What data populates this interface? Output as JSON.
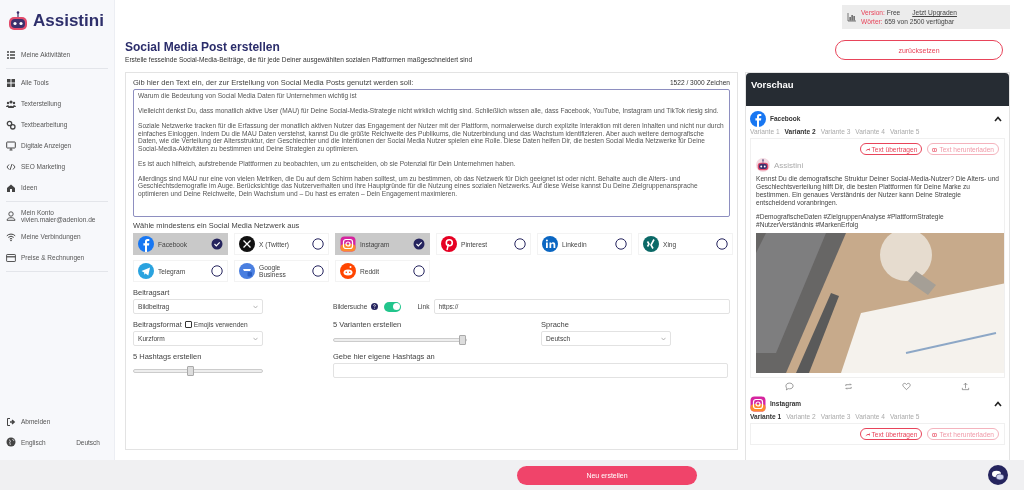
{
  "brand": {
    "name": "Assistini"
  },
  "usage": {
    "version_label": "Version:",
    "version": "Free",
    "upgrade_link": "Jetzt Upgraden",
    "words_label": "Wörter:",
    "words": "659 von 2500 verfügbar"
  },
  "sidebar": {
    "sections": [
      {
        "items": [
          {
            "label": "Meine Aktivitäten"
          }
        ]
      },
      {
        "items": [
          {
            "label": "Alle Tools"
          },
          {
            "label": "Texterstellung"
          },
          {
            "label": "Textbearbeitung"
          },
          {
            "label": "Digitale Anzeigen"
          },
          {
            "label": "SEO Marketing"
          },
          {
            "label": "Ideen"
          }
        ]
      },
      {
        "items": [
          {
            "label": "Mein Konto",
            "sublabel": "vivien.maier@adenion.de"
          },
          {
            "label": "Meine Verbindungen"
          },
          {
            "label": "Preise & Rechnungen"
          }
        ]
      }
    ],
    "logout": "Abmelden",
    "languages": [
      "Englisch",
      "Deutsch"
    ]
  },
  "page": {
    "title": "Social Media Post erstellen",
    "subtitle": "Erstelle fesselnde Social-Media-Beiträge, die für jede Deiner ausgewählten sozialen Plattformen maßgeschneidert sind",
    "reset_button": "zurücksetzen"
  },
  "input": {
    "label": "Gib hier den Text ein, der zur Erstellung von Social Media Posts genutzt werden soll:",
    "counter": "1522 / 3000 Zeichen",
    "paragraphs": [
      "Warum die Bedeutung von Social Media Daten für Unternehmen wichtig ist",
      "Vielleicht denkst Du, dass monatlich aktive User (MAU) für Deine Social-Media-Strategie nicht wirklich wichtig sind. Schließlich wissen alle, dass Facebook, YouTube, Instagram und TikTok riesig sind.",
      "Soziale Netzwerke tracken für die Erfassung der monatlich aktiven Nutzer das Engagement der Nutzer mit der Plattform, normalerweise durch explizite Interaktion mit deren Inhalten und nicht nur durch einfaches Einloggen. Indem Du die MAU Daten verstehst, kannst Du die größte Reichweite des Publikums, die Nutzerbindung und das Wachstum identifizieren. Aber auch weitere demografische Daten, wie die Verteilung der Altersstruktur, der Geschlechter und die Intentionen der Social Media Nutzer spielen eine Rolle. Diese Daten helfen Dir, die besten Social Media Netzwerke für Deine Social-Media-Aktivitäten zu bestimmen und Deine Strategien zu optimieren.",
      "Es ist auch hilfreich, aufstrebende Plattformen zu beobachten, um zu entscheiden, ob sie Potenzial für Dein Unternehmen haben.",
      "Allerdings sind MAU nur eine von vielen Metriken, die Du auf dem Schirm haben solltest, um zu bestimmen, ob das Netzwerk für Dich geeignet ist oder nicht. Behalte auch die Alters- und Geschlechtsdemografie im Auge. Berücksichtige das Nutzerverhalten und ihre Hauptgründe für die Nutzung eines sozialen Netzwerks. Auf diese Weise kannst Du Deine Zielgruppenansprache optimieren und Deine Reichweite, Dein Wachstum und – Du hast es erraten – Dein Engagement maximieren."
    ]
  },
  "networks": {
    "label": "Wähle mindestens ein Social Media Netzwerk aus",
    "items": [
      {
        "name": "Facebook",
        "selected": true
      },
      {
        "name": "X (Twitter)",
        "selected": false
      },
      {
        "name": "Instagram",
        "selected": true
      },
      {
        "name": "Pinterest",
        "selected": false
      },
      {
        "name": "Linkedin",
        "selected": false
      },
      {
        "name": "Xing",
        "selected": false
      },
      {
        "name": "Telegram",
        "selected": false
      },
      {
        "name": "Google Business",
        "selected": false
      },
      {
        "name": "Reddit",
        "selected": false
      }
    ]
  },
  "form": {
    "post_type": {
      "label": "Beitragsart",
      "value": "Bildbeitrag"
    },
    "image_search": {
      "label": "Bildersuche",
      "on": true
    },
    "link": {
      "label": "Link",
      "value": "https://"
    },
    "post_format": {
      "label": "Beitragsformat",
      "value": "Kurzform"
    },
    "emojis": {
      "label": "Emojis verwenden",
      "checked": false
    },
    "variants": {
      "label": "5 Varianten erstellen",
      "level": 1
    },
    "language": {
      "label": "Sprache",
      "value": "Deutsch"
    },
    "hashtags": {
      "label": "5 Hashtags erstellen",
      "level": 0.44
    },
    "own_hashtags": {
      "label": "Gebe hier eigene Hashtags an"
    }
  },
  "preview": {
    "title": "Vorschau",
    "sections": [
      {
        "network": "Facebook",
        "expanded": true,
        "variants": [
          {
            "label": "Variante 1",
            "selected": false
          },
          {
            "label": "Variante 2",
            "selected": true
          },
          {
            "label": "Variante 3",
            "selected": false
          },
          {
            "label": "Variante 4",
            "selected": false
          },
          {
            "label": "Variante 5",
            "selected": false
          }
        ],
        "post": {
          "transfer_button": {
            "label": "Text übertragen",
            "disabled": false
          },
          "download_button": {
            "label": "Text herunterladen",
            "disabled": true
          },
          "author": "Assistini",
          "text": "Kennst Du die demografische Struktur Deiner Social-Media-Nutzer? Die Alters- und Geschlechtsverteilung hilft Dir, die besten Plattformen für Deine Marke zu bestimmen. Ein genaues Verständnis der Nutzer kann Deine Strategie entscheidend voranbringen.",
          "hashtags": "#DemografischeDaten #ZielgruppenAnalyse #PlattformStrategie #NutzerVerständnis #MarkenErfolg"
        }
      },
      {
        "network": "Instagram",
        "expanded": true,
        "variants": [
          {
            "label": "Variante 1",
            "selected": true
          },
          {
            "label": "Variante 2",
            "selected": false
          },
          {
            "label": "Variante 3",
            "selected": false
          },
          {
            "label": "Variante 4",
            "selected": false
          },
          {
            "label": "Variante 5",
            "selected": false
          }
        ],
        "post": {
          "transfer_button": {
            "label": "Text übertragen",
            "disabled": false
          },
          "download_button": {
            "label": "Text herunterladen",
            "disabled": true
          }
        }
      }
    ]
  },
  "footer": {
    "create_button": "Neu erstellen"
  }
}
